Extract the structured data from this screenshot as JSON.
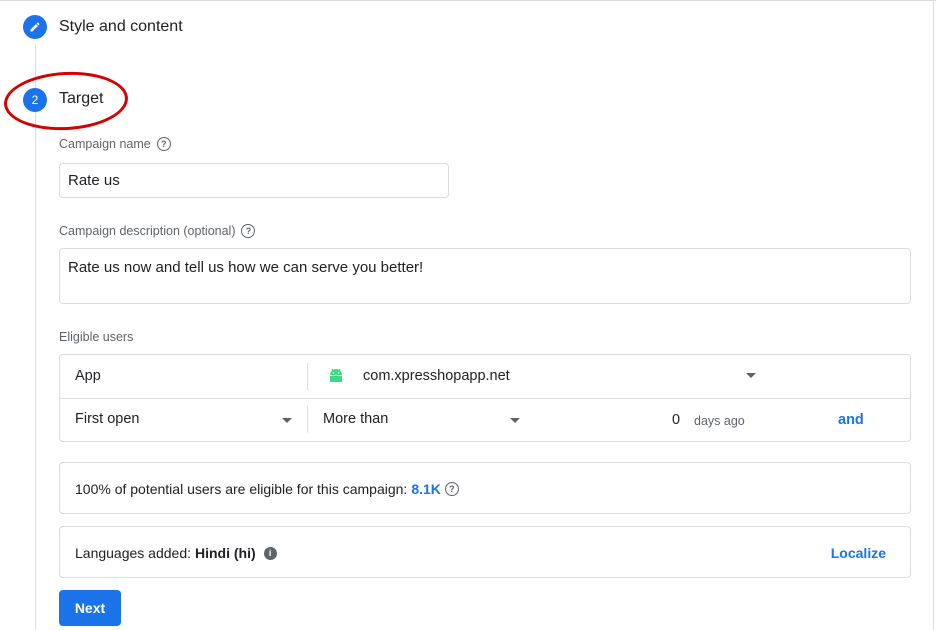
{
  "steps": {
    "step1": {
      "icon": "pencil-icon",
      "title": "Style and content"
    },
    "step2": {
      "number": "2",
      "title": "Target"
    }
  },
  "campaign_name": {
    "label": "Campaign name",
    "value": "Rate us"
  },
  "campaign_description": {
    "label": "Campaign description (optional)",
    "value": "Rate us now and tell us how we can serve you better!"
  },
  "eligible_users": {
    "label": "Eligible users",
    "row1": {
      "attribute": "App",
      "app_icon": "android-icon",
      "app_value": "com.xpresshopapp.net"
    },
    "row2": {
      "event": "First open",
      "comparator": "More than",
      "days_value": "0",
      "days_suffix": "days ago",
      "and_label": "and"
    }
  },
  "potential": {
    "text": "100% of potential users are eligible for this campaign:",
    "value": "8.1K"
  },
  "languages": {
    "text": "Languages added:",
    "value": "Hindi (hi)",
    "action": "Localize"
  },
  "next_label": "Next",
  "colors": {
    "accent": "#1a73e8",
    "annotation": "#d50000",
    "border": "#dadce0"
  }
}
